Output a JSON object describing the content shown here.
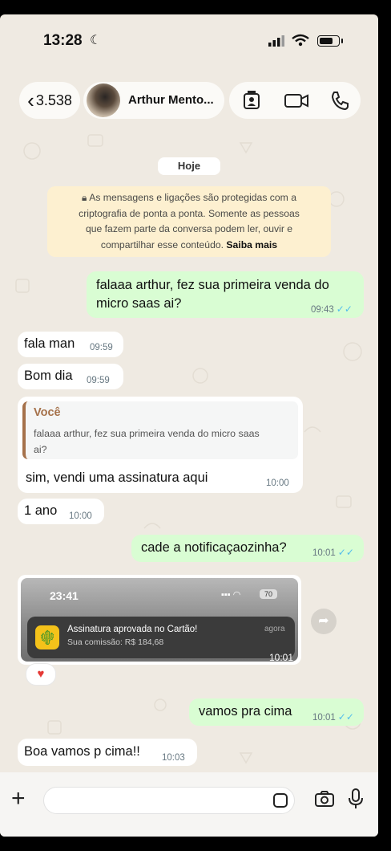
{
  "status_bar": {
    "time": "13:28",
    "icons": [
      "moon-icon",
      "signal-icon",
      "wifi-icon",
      "battery-icon"
    ]
  },
  "header": {
    "back_count": "3.538",
    "contact_name": "Arthur Mento...",
    "actions": [
      "contact-card-icon",
      "video-call-icon",
      "voice-call-icon"
    ]
  },
  "date_chip": "Hoje",
  "encryption_notice": {
    "text": "As mensagens e ligações são protegidas com a criptografia de ponta a ponta. Somente as pessoas que fazem parte da conversa podem ler, ouvir e compartilhar esse conteúdo.",
    "lines": [
      "As mensagens e ligações são protegidas com a",
      "criptografia de ponta a ponta. Somente as pessoas",
      "que fazem parte da conversa podem ler, ouvir e",
      "compartilhar esse conteúdo."
    ],
    "link": "Saiba mais"
  },
  "messages": [
    {
      "id": "m1",
      "dir": "out",
      "lines": [
        "falaaa arthur, fez sua primeira venda do",
        "micro saas ai?"
      ],
      "time": "09:43",
      "status": "read"
    },
    {
      "id": "m2",
      "dir": "in",
      "text": "fala man",
      "time": "09:59"
    },
    {
      "id": "m3",
      "dir": "in",
      "text": "Bom dia",
      "time": "09:59"
    },
    {
      "id": "m4",
      "dir": "in",
      "reply_to": {
        "author": "Você",
        "lines": [
          "falaaa arthur, fez sua primeira venda do micro saas",
          "ai?"
        ]
      },
      "text": "sim, vendi uma assinatura aqui",
      "time": "10:00"
    },
    {
      "id": "m5",
      "dir": "in",
      "text": "1 ano",
      "time": "10:00"
    },
    {
      "id": "m6",
      "dir": "out",
      "text": "cade a notificaçaozinha?",
      "time": "10:01",
      "status": "read"
    },
    {
      "id": "m7",
      "dir": "in",
      "type": "image",
      "time": "10:01",
      "reaction": "♥",
      "image_content": {
        "phone_time": "23:41",
        "battery": "70",
        "notif_title": "Assinatura aprovada no Cartão!",
        "notif_sub": "Sua comissão: R$ 184,68",
        "notif_when": "agora"
      }
    },
    {
      "id": "m8",
      "dir": "out",
      "text": "vamos pra cima",
      "time": "10:01",
      "status": "read"
    },
    {
      "id": "m9",
      "dir": "in",
      "text": "Boa vamos p cima!!",
      "time": "10:03"
    }
  ],
  "composer": {
    "placeholder": "",
    "icons": [
      "plus-icon",
      "sticker-icon",
      "camera-icon",
      "mic-icon"
    ]
  },
  "colors": {
    "bg": "#efeae2",
    "incoming": "#ffffff",
    "outgoing": "#d9fdd3",
    "read_tick": "#53bdeb",
    "notice": "#fdf0d0",
    "reply_accent": "#a5714a"
  }
}
